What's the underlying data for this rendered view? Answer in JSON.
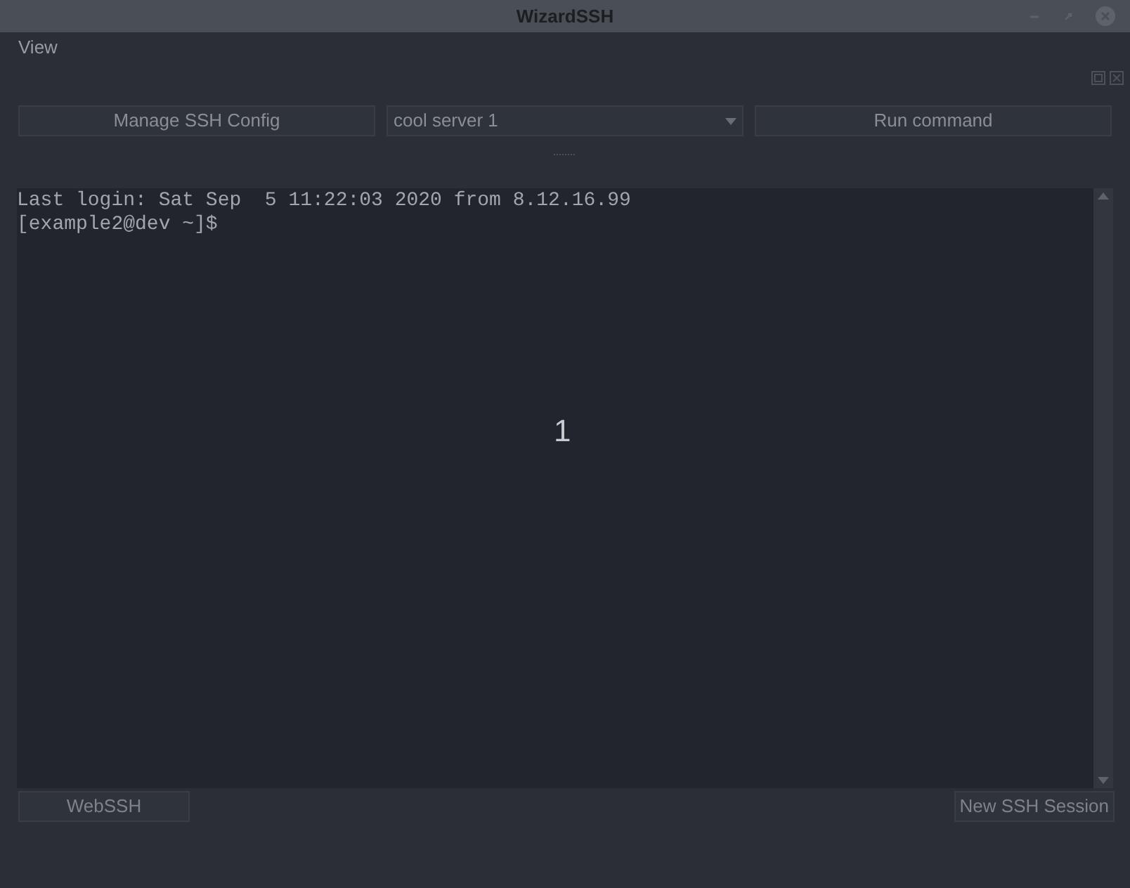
{
  "window": {
    "title": "WizardSSH"
  },
  "menu": [
    {
      "label": "View"
    }
  ],
  "toolbar": {
    "manage_button": "Manage SSH Config",
    "server_select": {
      "value": "cool server 1"
    },
    "run_button": "Run command"
  },
  "terminal": {
    "lines": [
      "Last login: Sat Sep  5 11:22:03 2020 from 8.12.16.99",
      "[example2@dev ~]$"
    ],
    "overlay": "1"
  },
  "tabs": [
    {
      "label": "WebSSH",
      "selected": true
    }
  ],
  "new_session_button": "New SSH Session"
}
